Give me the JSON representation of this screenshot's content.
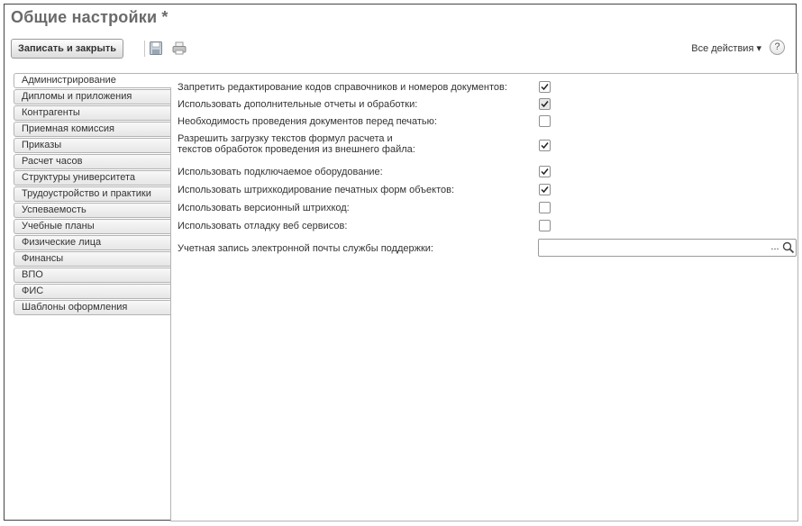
{
  "window": {
    "title": "Общие настройки *"
  },
  "toolbar": {
    "save_close_label": "Записать и закрыть",
    "all_actions_label": "Все действия ▾",
    "help_label": "?"
  },
  "tabs": [
    {
      "label": "Администрирование",
      "active": true
    },
    {
      "label": "Дипломы и приложения"
    },
    {
      "label": "Контрагенты"
    },
    {
      "label": "Приемная комиссия"
    },
    {
      "label": "Приказы"
    },
    {
      "label": "Расчет часов"
    },
    {
      "label": "Структуры университета"
    },
    {
      "label": "Трудоустройство и практики"
    },
    {
      "label": "Успеваемость"
    },
    {
      "label": "Учебные планы"
    },
    {
      "label": "Физические лица"
    },
    {
      "label": "Финансы"
    },
    {
      "label": "ВПО"
    },
    {
      "label": "ФИС"
    },
    {
      "label": "Шаблоны оформления"
    }
  ],
  "settings": [
    {
      "label": "Запретить редактирование кодов справочников и номеров документов:",
      "checked": true
    },
    {
      "label": "Использовать дополнительные отчеты и обработки:",
      "checked": true
    },
    {
      "label": "Необходимость проведения документов перед печатью:",
      "checked": false
    },
    {
      "label": "Разрешить загрузку текстов формул расчета и",
      "label2": "текстов обработок проведения из внешнего файла:",
      "checked": true
    },
    {
      "label": "Использовать подключаемое оборудование:",
      "checked": true
    },
    {
      "label": "Использовать штрихкодирование печатных форм объектов:",
      "checked": true
    },
    {
      "label": "Использовать версионный штрихкод:",
      "checked": false
    },
    {
      "label": "Использовать отладку веб сервисов:",
      "checked": false
    }
  ],
  "email": {
    "label": "Учетная запись электронной почты службы поддержки:",
    "value": "",
    "ellipsis": "..."
  }
}
